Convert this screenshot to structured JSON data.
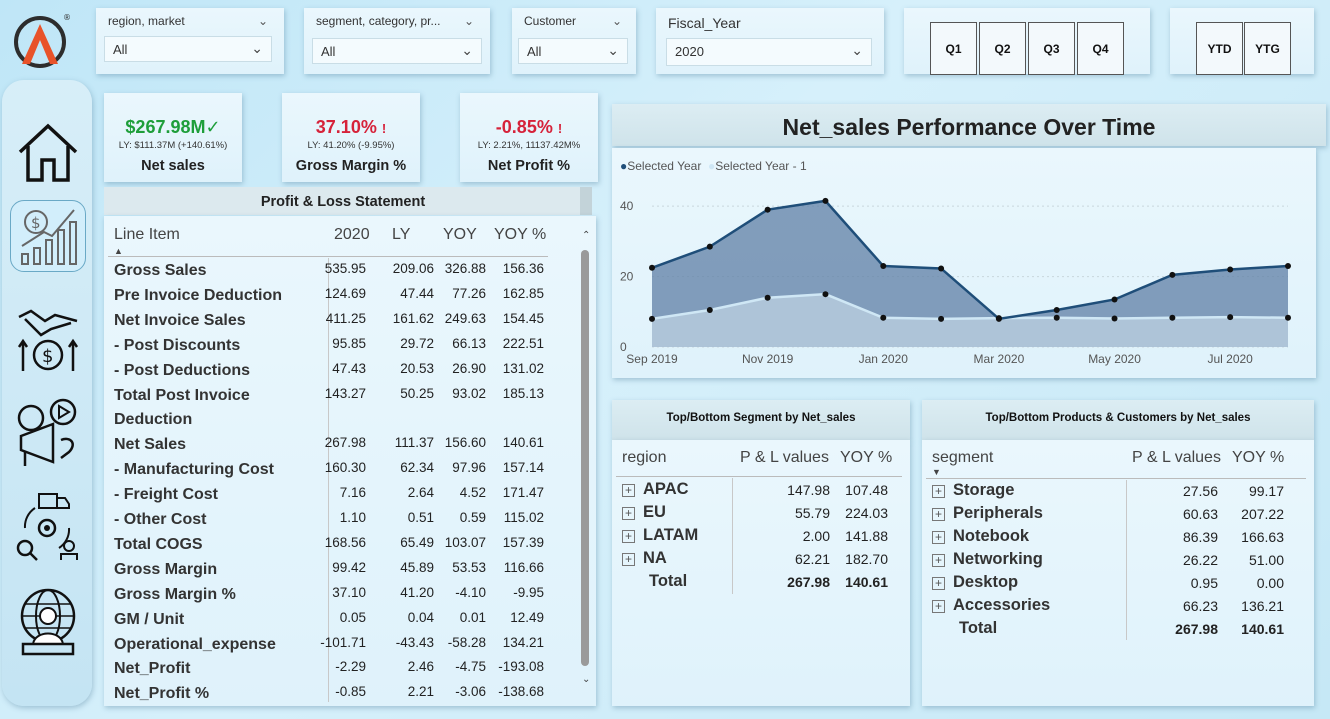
{
  "slicers": {
    "region": {
      "label": "region, market",
      "value": "All"
    },
    "segment": {
      "label": "segment, category, pr...",
      "value": "All"
    },
    "customer": {
      "label": "Customer",
      "value": "All"
    },
    "fiscal_year": {
      "label": "Fiscal_Year",
      "value": "2020"
    }
  },
  "quarters": [
    "Q1",
    "Q2",
    "Q3",
    "Q4"
  ],
  "periods": [
    "YTD",
    "YTG"
  ],
  "nav": [
    "home-icon",
    "finance-growth-icon",
    "handshake-money-icon",
    "marketing-megaphone-icon",
    "supply-chain-icon",
    "executive-globe-icon"
  ],
  "kpis": [
    {
      "value": "$267.98M",
      "flag": "✓",
      "ly": "LY: $111.37M (+140.61%)",
      "name": "Net sales",
      "color": "#1e9e3a"
    },
    {
      "value": "37.10%",
      "flag": "!",
      "ly": "LY: 41.20% (-9.95%)",
      "name": "Gross Margin %",
      "color": "#d6223a"
    },
    {
      "value": "-0.85%",
      "flag": "!",
      "ly": "LY: 2.21%, 11137.42M%",
      "name": "Net Profit %",
      "color": "#d6223a"
    }
  ],
  "pl": {
    "title": "Profit & Loss Statement",
    "headers": [
      "Line Item",
      "2020",
      "LY",
      "YOY",
      "YOY %"
    ],
    "rows": [
      {
        "name": "Gross Sales",
        "v": [
          "535.95",
          "209.06",
          "326.88",
          "156.36"
        ]
      },
      {
        "name": "Pre Invoice Deduction",
        "v": [
          "124.69",
          "47.44",
          "77.26",
          "162.85"
        ]
      },
      {
        "name": "Net Invoice Sales",
        "v": [
          "411.25",
          "161.62",
          "249.63",
          "154.45"
        ]
      },
      {
        "name": "- Post Discounts",
        "v": [
          "95.85",
          "29.72",
          "66.13",
          "222.51"
        ]
      },
      {
        "name": "- Post Deductions",
        "v": [
          "47.43",
          "20.53",
          "26.90",
          "131.02"
        ]
      },
      {
        "name": "Total Post Invoice",
        "v": [
          "143.27",
          "50.25",
          "93.02",
          "185.13"
        ]
      },
      {
        "name": "Deduction",
        "v": [
          "",
          "",
          "",
          ""
        ]
      },
      {
        "name": "Net Sales",
        "v": [
          "267.98",
          "111.37",
          "156.60",
          "140.61"
        ]
      },
      {
        "name": "- Manufacturing Cost",
        "v": [
          "160.30",
          "62.34",
          "97.96",
          "157.14"
        ]
      },
      {
        "name": "- Freight Cost",
        "v": [
          "7.16",
          "2.64",
          "4.52",
          "171.47"
        ]
      },
      {
        "name": "- Other Cost",
        "v": [
          "1.10",
          "0.51",
          "0.59",
          "115.02"
        ]
      },
      {
        "name": "Total COGS",
        "v": [
          "168.56",
          "65.49",
          "103.07",
          "157.39"
        ]
      },
      {
        "name": "Gross Margin",
        "v": [
          "99.42",
          "45.89",
          "53.53",
          "116.66"
        ]
      },
      {
        "name": "Gross Margin %",
        "v": [
          "37.10",
          "41.20",
          "-4.10",
          "-9.95"
        ]
      },
      {
        "name": "GM / Unit",
        "v": [
          "0.05",
          "0.04",
          "0.01",
          "12.49"
        ]
      },
      {
        "name": "Operational_expense",
        "v": [
          "-101.71",
          "-43.43",
          "-58.28",
          "134.21"
        ]
      },
      {
        "name": "Net_Profit",
        "v": [
          "-2.29",
          "2.46",
          "-4.75",
          "-193.08"
        ]
      },
      {
        "name": "Net_Profit %",
        "v": [
          "-0.85",
          "2.21",
          "-3.06",
          "-138.68"
        ]
      }
    ]
  },
  "chart_data": {
    "type": "area",
    "title": "Net_sales Performance Over Time",
    "x": [
      "Sep 2019",
      "Oct 2019",
      "Nov 2019",
      "Dec 2019",
      "Jan 2020",
      "Feb 2020",
      "Mar 2020",
      "Apr 2020",
      "May 2020",
      "Jun 2020",
      "Jul 2020",
      "Aug 2020"
    ],
    "xticks": [
      "Sep 2019",
      "Nov 2019",
      "Jan 2020",
      "Mar 2020",
      "May 2020",
      "Jul 2020"
    ],
    "series": [
      {
        "name": "Selected Year",
        "values": [
          22.5,
          28.5,
          39,
          41.5,
          23,
          22.3,
          8,
          10.5,
          13.5,
          20.5,
          22,
          23
        ],
        "color": "#1f4e79"
      },
      {
        "name": "Selected Year - 1",
        "values": [
          8,
          10.5,
          14,
          15,
          8.3,
          8,
          8.2,
          8.3,
          8.1,
          8.3,
          8.5,
          8.3
        ],
        "color": "#cfe7f5"
      }
    ],
    "ylim": [
      0,
      48
    ],
    "yticks": [
      0,
      20,
      40
    ],
    "legend": "top-left",
    "grid": true
  },
  "seg_table": {
    "title": "Top/Bottom Segment by Net_sales",
    "headers": [
      "region",
      "P & L values",
      "YOY %"
    ],
    "rows": [
      {
        "name": "APAC",
        "v": [
          "147.98",
          "107.48"
        ]
      },
      {
        "name": "EU",
        "v": [
          "55.79",
          "224.03"
        ]
      },
      {
        "name": "LATAM",
        "v": [
          "2.00",
          "141.88"
        ]
      },
      {
        "name": "NA",
        "v": [
          "62.21",
          "182.70"
        ]
      }
    ],
    "total": {
      "name": "Total",
      "v": [
        "267.98",
        "140.61"
      ]
    }
  },
  "prod_table": {
    "title": "Top/Bottom Products & Customers by Net_sales",
    "headers": [
      "segment",
      "P & L values",
      "YOY %"
    ],
    "rows": [
      {
        "name": "Storage",
        "v": [
          "27.56",
          "99.17"
        ]
      },
      {
        "name": "Peripherals",
        "v": [
          "60.63",
          "207.22"
        ]
      },
      {
        "name": "Notebook",
        "v": [
          "86.39",
          "166.63"
        ]
      },
      {
        "name": "Networking",
        "v": [
          "26.22",
          "51.00"
        ]
      },
      {
        "name": "Desktop",
        "v": [
          "0.95",
          "0.00"
        ]
      },
      {
        "name": "Accessories",
        "v": [
          "66.23",
          "136.21"
        ]
      }
    ],
    "total": {
      "name": "Total",
      "v": [
        "267.98",
        "140.61"
      ]
    }
  }
}
